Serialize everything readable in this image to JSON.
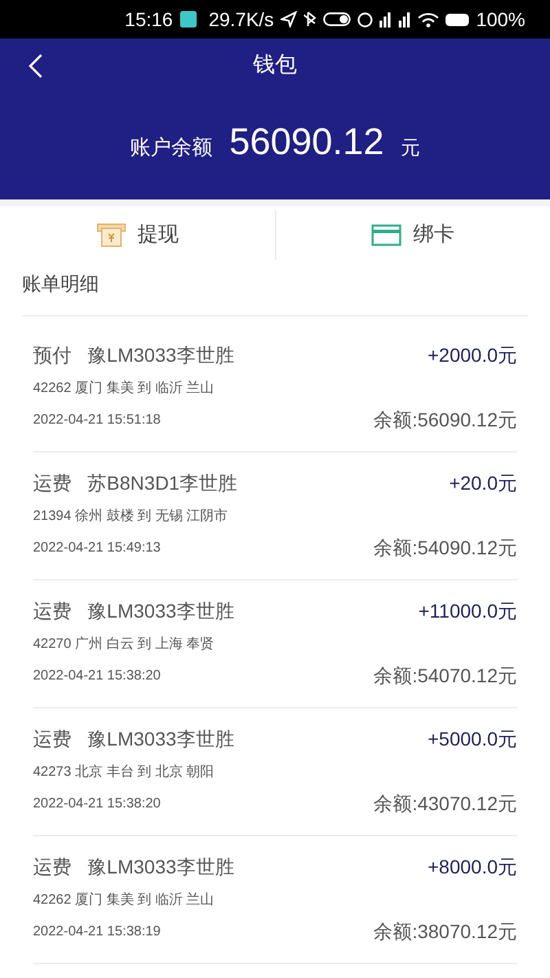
{
  "status_bar": {
    "time": "15:16",
    "speed": "29.7K/s",
    "battery": "100%"
  },
  "header": {
    "title": "钱包",
    "balance_label": "账户余额",
    "balance": "56090.12",
    "unit": "元"
  },
  "actions": [
    {
      "kind": "withdraw",
      "label": "提现"
    },
    {
      "kind": "card",
      "label": "绑卡"
    }
  ],
  "section_title": "账单明细",
  "transactions": [
    {
      "type": "预付",
      "party": "豫LM3033李世胜",
      "amount": "+2000.0元",
      "route": "42262 厦门 集美 到 临沂 兰山",
      "time": "2022-04-21 15:51:18",
      "balance": "余额:56090.12元"
    },
    {
      "type": "运费",
      "party": "苏B8N3D1李世胜",
      "amount": "+20.0元",
      "route": "21394 徐州 鼓楼 到 无锡 江阴市",
      "time": "2022-04-21 15:49:13",
      "balance": "余额:54090.12元"
    },
    {
      "type": "运费",
      "party": "豫LM3033李世胜",
      "amount": "+11000.0元",
      "route": "42270 广州 白云 到 上海 奉贤",
      "time": "2022-04-21 15:38:20",
      "balance": "余额:54070.12元"
    },
    {
      "type": "运费",
      "party": "豫LM3033李世胜",
      "amount": "+5000.0元",
      "route": "42273 北京 丰台 到 北京 朝阳",
      "time": "2022-04-21 15:38:20",
      "balance": "余额:43070.12元"
    },
    {
      "type": "运费",
      "party": "豫LM3033李世胜",
      "amount": "+8000.0元",
      "route": "42262 厦门 集美 到 临沂 兰山",
      "time": "2022-04-21 15:38:19",
      "balance": "余额:38070.12元"
    }
  ]
}
